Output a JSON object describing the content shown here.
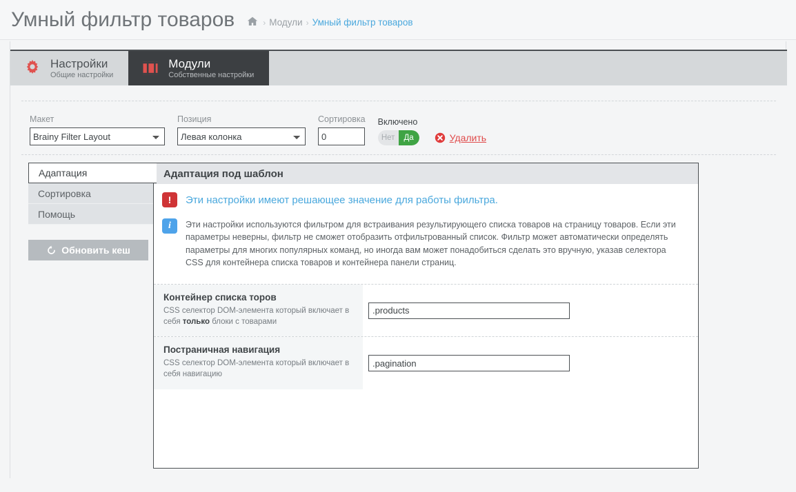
{
  "header": {
    "title": "Умный фильтр товаров",
    "breadcrumb": {
      "home_icon": "home-icon",
      "sep": "›",
      "parent": "Модули",
      "current": "Умный фильтр товаров"
    }
  },
  "tabs": [
    {
      "icon": "gear-icon",
      "title": "Настройки",
      "subtitle": "Общие настройки",
      "active": false
    },
    {
      "icon": "layout-icon",
      "title": "Модули",
      "subtitle": "Собственные настройки",
      "active": true
    }
  ],
  "toolbar": {
    "layout": {
      "label": "Макет",
      "value": "Brainy Filter Layout"
    },
    "position": {
      "label": "Позиция",
      "value": "Левая колонка"
    },
    "sorting": {
      "label": "Сортировка",
      "value": "0"
    },
    "enabled": {
      "label": "Включено",
      "off_label": "Нет",
      "on_label": "Да",
      "state": "on"
    },
    "delete": {
      "label": "Удалить",
      "icon": "delete-circle-icon"
    }
  },
  "sidenav": {
    "items": [
      {
        "label": "Адаптация",
        "active": true
      },
      {
        "label": "Сортировка",
        "active": false
      },
      {
        "label": "Помощь",
        "active": false
      }
    ],
    "cache_button": {
      "label": "Обновить кеш",
      "icon": "refresh-icon"
    }
  },
  "panel": {
    "heading": "Адаптация под шаблон",
    "alerts": [
      {
        "icon": "exclamation-icon",
        "type": "danger",
        "text": "Эти настройки имеют решающее значение для работы фильтра."
      },
      {
        "icon": "info-icon",
        "type": "info",
        "text": "Эти настройки используются фильтром для встраивания результирующего списка товаров на страницу товаров. Если эти параметры неверны, фильтр не сможет отобразить отфильтрованный список. Фильтр может автоматически определять параметры для многих популярных команд, но иногда вам может понадобиться сделать это вручную, указав селектора CSS для контейнера списка товаров и контейнера панели страниц."
      }
    ],
    "settings": [
      {
        "title": "Контейнер списка торов",
        "desc_before": "CSS селектор DOM-элемента который включает в себя ",
        "desc_bold": "только",
        "desc_after": " блоки с товарами",
        "value": ".products"
      },
      {
        "title": "Постраничная навигация",
        "desc_before": "CSS селектор DOM-элемента который включает в себя навигацию",
        "desc_bold": "",
        "desc_after": "",
        "value": ".pagination"
      }
    ]
  },
  "colors": {
    "accent_red": "#e04b4b",
    "brand_red": "#e0524f",
    "link_blue": "#4aa8dd",
    "toggle_green": "#3fa444",
    "danger": "#cf3436",
    "info": "#4ea3ea"
  }
}
